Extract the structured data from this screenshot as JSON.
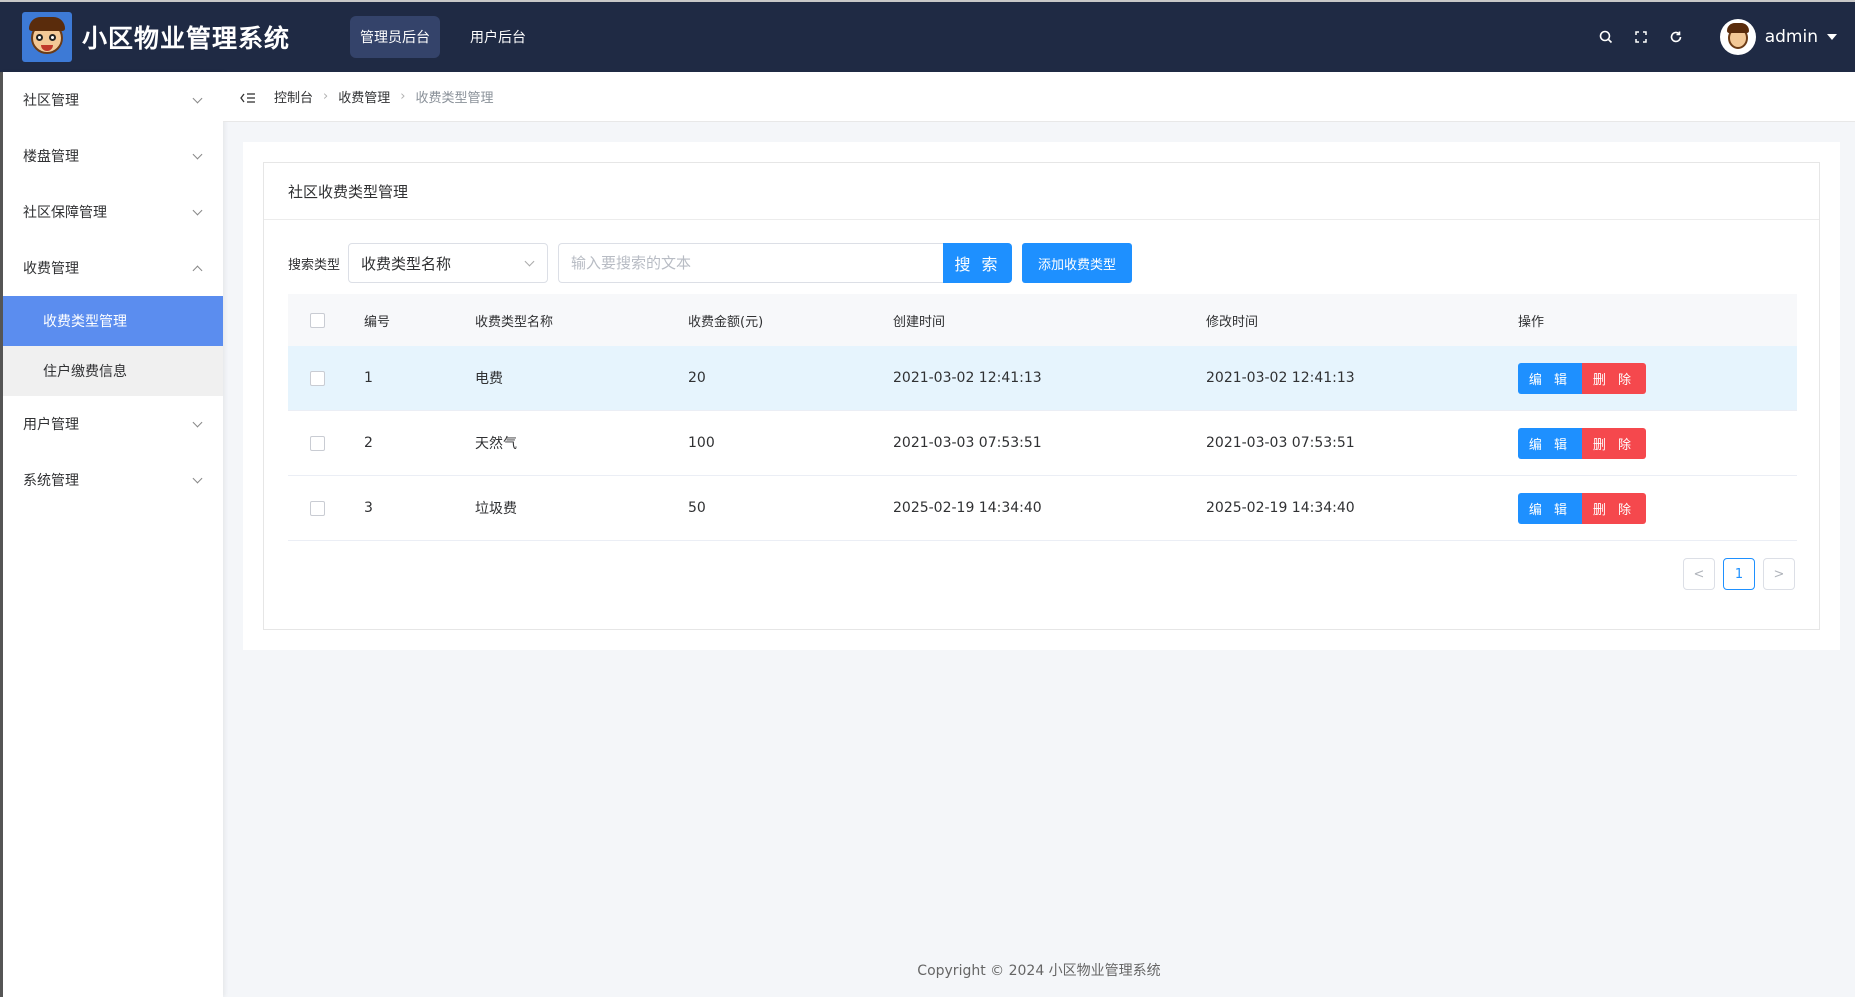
{
  "header": {
    "title": "小区物业管理系统",
    "tabs": [
      "管理员后台",
      "用户后台"
    ],
    "user": "admin"
  },
  "sidebar": {
    "items": [
      {
        "label": "社区管理"
      },
      {
        "label": "楼盘管理"
      },
      {
        "label": "社区保障管理"
      },
      {
        "label": "收费管理",
        "expanded": true,
        "children": [
          "收费类型管理",
          "住户缴费信息"
        ]
      },
      {
        "label": "用户管理"
      },
      {
        "label": "系统管理"
      }
    ]
  },
  "breadcrumb": [
    "控制台",
    "收费管理",
    "收费类型管理"
  ],
  "card": {
    "title": "社区收费类型管理",
    "search_label": "搜索类型",
    "select_value": "收费类型名称",
    "search_placeholder": "输入要搜索的文本",
    "search_button": "搜 索",
    "add_button": "添加收费类型"
  },
  "table": {
    "columns": [
      "编号",
      "收费类型名称",
      "收费金额(元)",
      "创建时间",
      "修改时间",
      "操作"
    ],
    "rows": [
      {
        "id": "1",
        "name": "电费",
        "amount": "20",
        "created": "2021-03-02 12:41:13",
        "modified": "2021-03-02 12:41:13"
      },
      {
        "id": "2",
        "name": "天然气",
        "amount": "100",
        "created": "2021-03-03 07:53:51",
        "modified": "2021-03-03 07:53:51"
      },
      {
        "id": "3",
        "name": "垃圾费",
        "amount": "50",
        "created": "2025-02-19 14:34:40",
        "modified": "2025-02-19 14:34:40"
      }
    ],
    "edit_label": "编 辑",
    "delete_label": "删 除"
  },
  "pagination": {
    "current": "1",
    "prev": "<",
    "next": ">"
  },
  "footer": "Copyright © 2024 小区物业管理系统",
  "colors": {
    "header_bg": "#1f2a44",
    "primary": "#1e90ff",
    "danger": "#f5484d",
    "menu_active": "#5b8def"
  }
}
